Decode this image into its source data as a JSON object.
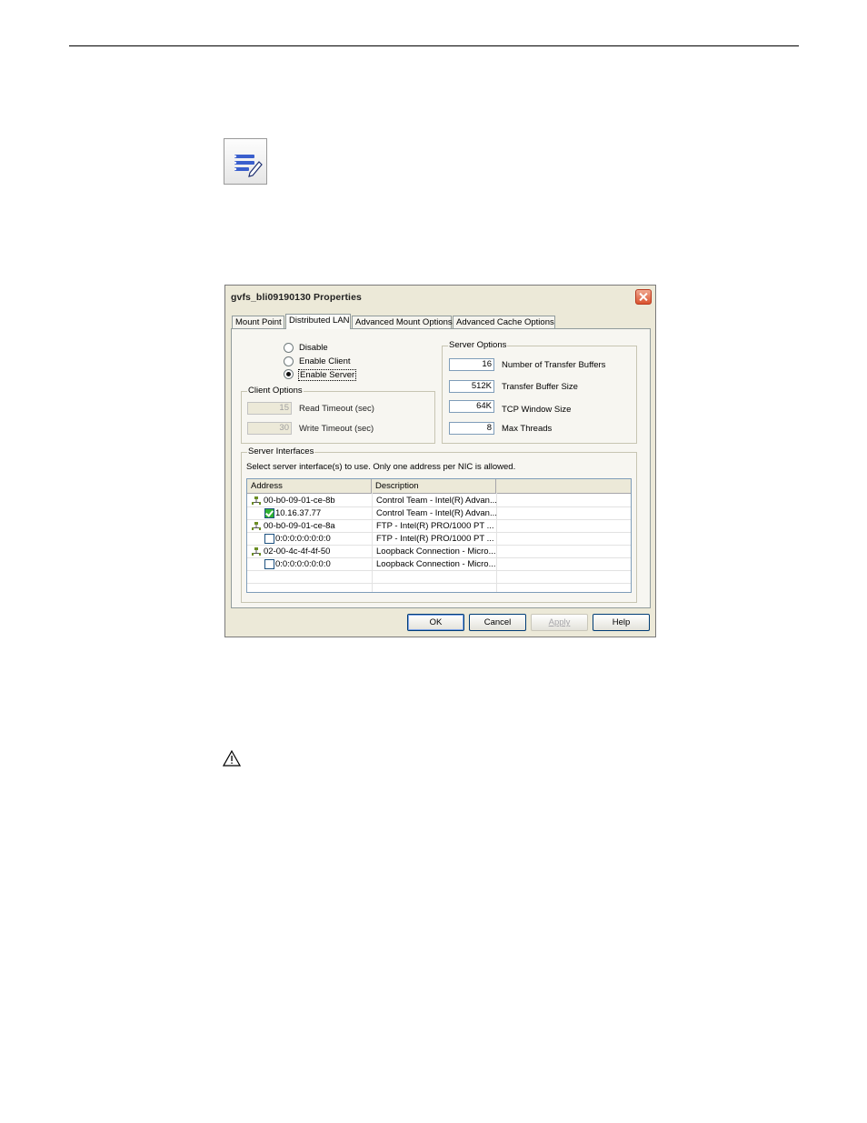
{
  "dialog": {
    "title": "gvfs_bli09190130 Properties",
    "tabs": [
      "Mount Point",
      "Distributed LAN",
      "Advanced Mount Options",
      "Advanced Cache Options"
    ],
    "active_tab": "Distributed LAN",
    "mode_options": [
      "Disable",
      "Enable Client",
      "Enable Server"
    ],
    "selected_mode": "Enable Server",
    "client_options": {
      "legend": "Client Options",
      "read_timeout_value": "15",
      "read_timeout_label": "Read Timeout (sec)",
      "write_timeout_value": "30",
      "write_timeout_label": "Write Timeout (sec)"
    },
    "server_options": {
      "legend": "Server Options",
      "transfer_buffers_value": "16",
      "transfer_buffers_label": "Number of Transfer Buffers",
      "buffer_size_value": "512K",
      "buffer_size_label": "Transfer Buffer Size",
      "tcp_window_value": "64K",
      "tcp_window_label": "TCP Window Size",
      "max_threads_value": "8",
      "max_threads_label": "Max Threads"
    },
    "server_interfaces": {
      "legend": "Server Interfaces",
      "instruction": "Select server interface(s) to use.  Only one address per NIC is allowed.",
      "columns": [
        "Address",
        "Description"
      ],
      "rows": [
        {
          "type": "nic",
          "address": "00-b0-09-01-ce-8b",
          "description": "Control Team - Intel(R) Advan..."
        },
        {
          "type": "ip",
          "checked": true,
          "address": "10.16.37.77",
          "description": "Control Team - Intel(R) Advan..."
        },
        {
          "type": "nic",
          "address": "00-b0-09-01-ce-8a",
          "description": "FTP - Intel(R) PRO/1000 PT ..."
        },
        {
          "type": "ip",
          "checked": false,
          "address": "0:0:0:0:0:0:0:0",
          "description": "FTP - Intel(R) PRO/1000 PT ..."
        },
        {
          "type": "nic",
          "address": "02-00-4c-4f-4f-50",
          "description": "Loopback Connection - Micro..."
        },
        {
          "type": "ip",
          "checked": false,
          "address": "0:0:0:0:0:0:0:0",
          "description": "Loopback Connection - Micro..."
        }
      ]
    },
    "buttons": {
      "ok": "OK",
      "cancel": "Cancel",
      "apply": "Apply",
      "help": "Help"
    }
  },
  "icons": {
    "note": "note-icon",
    "caution": "caution-icon",
    "close": "close-icon",
    "nic": "network-adapter-icon"
  },
  "colors": {
    "dialog_bg": "#ece9d8",
    "check_on": "#2fb12f",
    "close_button": "#d9532f"
  }
}
